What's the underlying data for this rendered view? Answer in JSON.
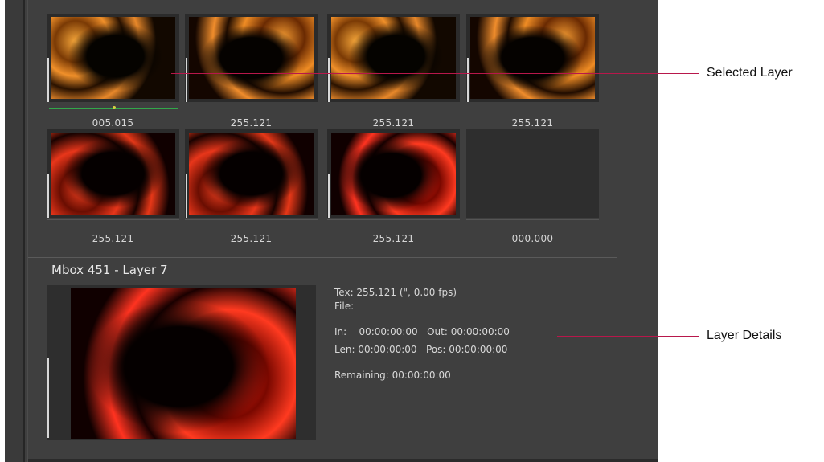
{
  "grid": {
    "thumbnails": [
      {
        "caption": "005.015",
        "style": "orange",
        "selected": true
      },
      {
        "caption": "255.121",
        "style": "orange2",
        "selected": false
      },
      {
        "caption": "255.121",
        "style": "orange",
        "selected": false
      },
      {
        "caption": "255.121",
        "style": "orange2",
        "selected": false
      },
      {
        "caption": "255.121",
        "style": "red",
        "selected": false
      },
      {
        "caption": "255.121",
        "style": "red",
        "selected": false
      },
      {
        "caption": "255.121",
        "style": "red-bright",
        "selected": false
      },
      {
        "caption": "000.000",
        "style": "empty",
        "selected": false
      }
    ]
  },
  "detail": {
    "title": "Mbox 451 - Layer 7",
    "tex": "Tex: 255.121 (\", 0.00 fps)",
    "file": "File:",
    "in_out": "In:    00:00:00:00   Out: 00:00:00:00",
    "len_pos": "Len: 00:00:00:00   Pos: 00:00:00:00",
    "remaining": "Remaining: 00:00:00:00"
  },
  "callouts": {
    "selected_layer": "Selected Layer",
    "layer_details": "Layer Details"
  },
  "colors": {
    "panel_bg": "#3f3f3f",
    "callout_line": "#b8174b",
    "selection_bar": "#32a84a"
  }
}
